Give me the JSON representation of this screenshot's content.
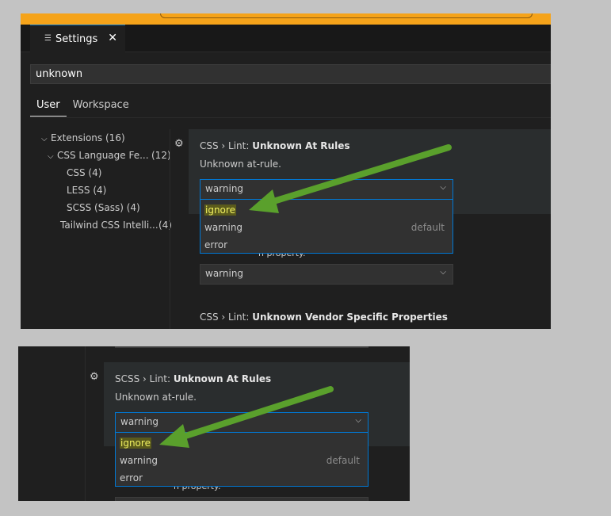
{
  "tab": {
    "icon": "settings-lines-icon",
    "label": "Settings",
    "close": "✕"
  },
  "search": {
    "value": "unknown"
  },
  "scopes": [
    "User",
    "Workspace"
  ],
  "toc": {
    "extensions": {
      "label": "Extensions",
      "count": "(16)"
    },
    "css_language": {
      "label": "CSS Language Fe...",
      "count": "(12)"
    },
    "css": "CSS (4)",
    "less": "LESS (4)",
    "scss": "SCSS (Sass) (4)",
    "tailwind": {
      "label": "Tailwind CSS Intelli...",
      "count": "(4)"
    }
  },
  "setting1": {
    "prefix": "CSS › Lint: ",
    "name": "Unknown At Rules",
    "description": "Unknown at-rule.",
    "value": "warning",
    "options": [
      "ignore",
      "warning",
      "error"
    ],
    "default_label": "default"
  },
  "setting2": {
    "value": "warning",
    "partial_text": "n property."
  },
  "setting3": {
    "prefix": "CSS › Lint: ",
    "name": "Unknown Vendor Specific Properties"
  },
  "scss_setting": {
    "prefix": "SCSS › Lint: ",
    "name": "Unknown At Rules",
    "description": "Unknown at-rule.",
    "value": "warning",
    "options": [
      "ignore",
      "warning",
      "error"
    ],
    "default_label": "default",
    "partial_text": "n property."
  },
  "colors": {
    "accent": "#0078d4",
    "arrow": "#5aa02c",
    "highlight": "#f0f060",
    "orange": "#f5a31a"
  }
}
